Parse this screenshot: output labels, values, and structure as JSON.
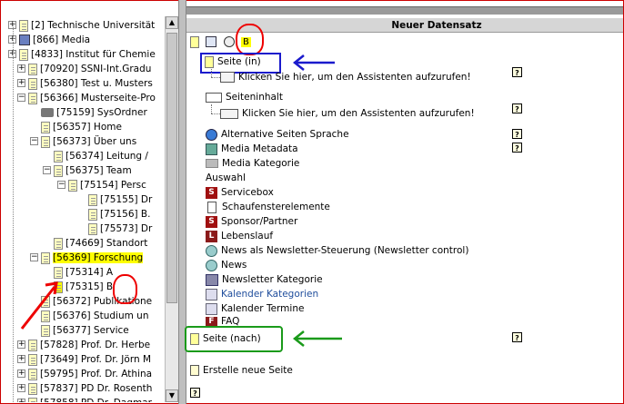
{
  "window": {
    "header_title": "Neuer Datensatz"
  },
  "tree": [
    {
      "label": "[2] Technische Universität",
      "indent": 0,
      "icon": "page-icon"
    },
    {
      "label": "[866] Media",
      "indent": 0,
      "icon": "database-icon"
    },
    {
      "label": "[4833] Institut für Chemie",
      "indent": 0,
      "icon": "page-icon"
    },
    {
      "label": "[70920] SSNI-Int.Gradu",
      "indent": 1,
      "icon": "page-icon"
    },
    {
      "label": "[56380] Test u. Musters",
      "indent": 1,
      "icon": "page-icon"
    },
    {
      "label": "[56366] Musterseite-Pro",
      "indent": 1,
      "icon": "page-icon"
    },
    {
      "label": "[75159] SysOrdner",
      "indent": 2,
      "icon": "sysfolder-icon"
    },
    {
      "label": "[56357] Home",
      "indent": 2,
      "icon": "page-icon"
    },
    {
      "label": "[56373] Über uns",
      "indent": 2,
      "icon": "page-icon"
    },
    {
      "label": "[56374] Leitung /",
      "indent": 3,
      "icon": "page-icon"
    },
    {
      "label": "[56375] Team",
      "indent": 3,
      "icon": "page-icon"
    },
    {
      "label": "[75154] Persc",
      "indent": 4,
      "icon": "page-icon"
    },
    {
      "label": "[75155] Dr",
      "indent": 5,
      "icon": "page-icon"
    },
    {
      "label": "[75156] B.",
      "indent": 5,
      "icon": "page-icon"
    },
    {
      "label": "[75573] Dr",
      "indent": 5,
      "icon": "page-icon"
    },
    {
      "label": "[74669] Standort",
      "indent": 3,
      "icon": "page-icon"
    },
    {
      "label": "[56369] Forschung",
      "indent": 2,
      "icon": "page-icon"
    },
    {
      "label": "[75314] A",
      "indent": 3,
      "icon": "page-icon"
    },
    {
      "label": "[75315] B",
      "indent": 3,
      "icon": "page-icon"
    },
    {
      "label": "[56372] Publikatione",
      "indent": 2,
      "icon": "page-icon"
    },
    {
      "label": "[56376] Studium un",
      "indent": 2,
      "icon": "page-icon"
    },
    {
      "label": "[56377] Service",
      "indent": 2,
      "icon": "page-icon"
    },
    {
      "label": "[57828] Prof. Dr. Herbe",
      "indent": 1,
      "icon": "page-icon"
    },
    {
      "label": "[73649] Prof. Dr. Jörn M",
      "indent": 1,
      "icon": "page-icon"
    },
    {
      "label": "[59795] Prof. Dr. Athina",
      "indent": 1,
      "icon": "page-icon"
    },
    {
      "label": "[57837] PD Dr. Rosenth",
      "indent": 1,
      "icon": "page-icon"
    },
    {
      "label": "[57858] PD Dr. Dagmar",
      "indent": 1,
      "icon": "page-icon"
    }
  ],
  "toolbar": {
    "current_page": "B"
  },
  "main": {
    "seite_in": "Seite (in)",
    "wizard1": "Klicken Sie hier, um den Assistenten aufzurufen!",
    "seiteninhalt": "Seiteninhalt",
    "wizard2": "Klicken Sie hier, um den Assistenten aufzurufen!",
    "items": [
      {
        "label": "Alternative Seiten Sprache",
        "icon": "globe-icon",
        "help": true
      },
      {
        "label": "Media Metadata",
        "icon": "media-icon",
        "help": true
      },
      {
        "label": "Media Kategorie",
        "icon": "folder-icon",
        "help": false
      }
    ],
    "auswahl": "Auswahl",
    "auswahl_items": [
      {
        "label": "Servicebox",
        "icon": "s-icon",
        "link": false
      },
      {
        "label": "Schaufensterelemente",
        "icon": "doc-icon",
        "link": false
      },
      {
        "label": "Sponsor/Partner",
        "icon": "s-icon",
        "link": false
      },
      {
        "label": "Lebenslauf",
        "icon": "l-icon",
        "link": false
      },
      {
        "label": "News als Newsletter-Steuerung (Newsletter control)",
        "icon": "news-icon",
        "link": false
      },
      {
        "label": "News",
        "icon": "news-icon",
        "link": false
      },
      {
        "label": "Newsletter Kategorie",
        "icon": "newsletter-icon",
        "link": false
      },
      {
        "label": "Kalender Kategorien",
        "icon": "calendar-icon",
        "link": true
      },
      {
        "label": "Kalender Termine",
        "icon": "calendar-icon",
        "link": false
      },
      {
        "label": "FAQ",
        "icon": "f-icon",
        "link": false
      }
    ],
    "seite_nach": "Seite (nach)",
    "create_page": "Erstelle neue Seite"
  }
}
